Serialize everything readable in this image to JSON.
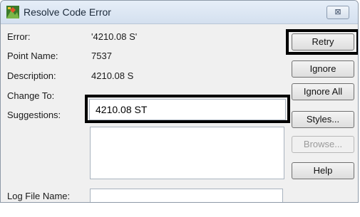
{
  "window": {
    "title": "Resolve Code Error",
    "close_glyph": "⊠"
  },
  "fields": {
    "error_label": "Error:",
    "error_value": "'4210.08 S'",
    "point_name_label": "Point Name:",
    "point_name_value": "7537",
    "description_label": "Description:",
    "description_value": "4210.08 S",
    "change_to_label": "Change To:",
    "change_to_value": "4210.08 ST",
    "suggestions_label": "Suggestions:",
    "log_file_label": "Log File Name:",
    "log_file_value": ""
  },
  "buttons": {
    "retry": "Retry",
    "ignore": "Ignore",
    "ignore_all": "Ignore All",
    "styles": "Styles...",
    "browse": "Browse...",
    "help": "Help"
  },
  "icons": {
    "app": "survey-app-icon",
    "close": "close-icon"
  }
}
